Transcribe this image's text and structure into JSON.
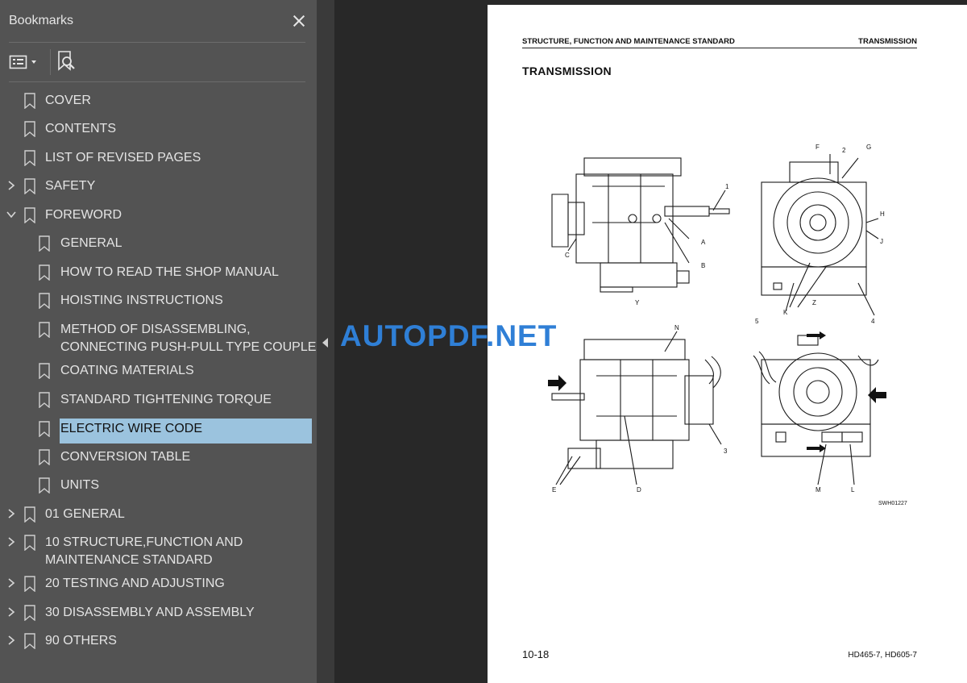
{
  "sidebar": {
    "title": "Bookmarks",
    "close_icon": "close-icon",
    "options_icon": "bookmark-options-icon",
    "find_icon": "find-current-bookmark-icon",
    "items": [
      {
        "label": "COVER",
        "level": 0,
        "expander": "none"
      },
      {
        "label": "CONTENTS",
        "level": 0,
        "expander": "none"
      },
      {
        "label": "LIST OF REVISED PAGES",
        "level": 0,
        "expander": "none"
      },
      {
        "label": "SAFETY",
        "level": 0,
        "expander": "collapsed"
      },
      {
        "label": "FOREWORD",
        "level": 0,
        "expander": "expanded"
      },
      {
        "label": "GENERAL",
        "level": 1,
        "expander": "none"
      },
      {
        "label": "HOW TO READ THE SHOP MANUAL",
        "level": 1,
        "expander": "none"
      },
      {
        "label": "HOISTING INSTRUCTIONS",
        "level": 1,
        "expander": "none"
      },
      {
        "label": "METHOD OF DISASSEMBLING,",
        "label2": "CONNECTING PUSH-PULL TYPE COUPLER",
        "level": 1,
        "expander": "none"
      },
      {
        "label": "COATING MATERIALS",
        "level": 1,
        "expander": "none"
      },
      {
        "label": "STANDARD TIGHTENING TORQUE",
        "level": 1,
        "expander": "none"
      },
      {
        "label": "ELECTRIC WIRE CODE",
        "level": 1,
        "expander": "none",
        "selected": true
      },
      {
        "label": "CONVERSION TABLE",
        "level": 1,
        "expander": "none"
      },
      {
        "label": "UNITS",
        "level": 1,
        "expander": "none"
      },
      {
        "label": "01 GENERAL",
        "level": 0,
        "expander": "collapsed"
      },
      {
        "label": "10 STRUCTURE,FUNCTION AND",
        "label2": "MAINTENANCE STANDARD",
        "level": 0,
        "expander": "collapsed"
      },
      {
        "label": "20 TESTING AND ADJUSTING",
        "level": 0,
        "expander": "collapsed"
      },
      {
        "label": "30 DISASSEMBLY AND ASSEMBLY",
        "level": 0,
        "expander": "collapsed"
      },
      {
        "label": "90 OTHERS",
        "level": 0,
        "expander": "collapsed"
      }
    ]
  },
  "document": {
    "header_left": "STRUCTURE, FUNCTION AND MAINTENANCE STANDARD",
    "header_right": "TRANSMISSION",
    "title": "TRANSMISSION",
    "figure_callouts": [
      "1",
      "2",
      "3",
      "4",
      "5",
      "A",
      "B",
      "C",
      "D",
      "E",
      "F",
      "G",
      "H",
      "J",
      "K",
      "L",
      "M",
      "N",
      "Y",
      "Z"
    ],
    "figure_code": "SWH01227",
    "page_number": "10-18",
    "model": "HD465-7, HD605-7"
  },
  "watermark": "AUTOPDF.NET",
  "colors": {
    "sidebar_bg": "#535353",
    "selection": "#9bc3de",
    "viewer_bg": "#282828",
    "watermark": "#2f7fd6"
  }
}
